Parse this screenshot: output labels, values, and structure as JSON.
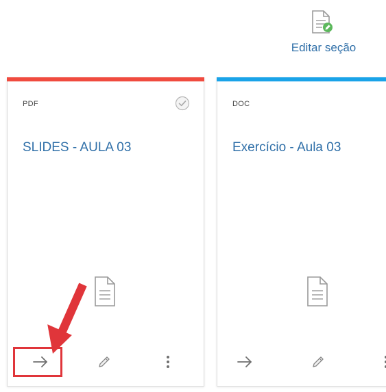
{
  "header": {
    "edit_section_label": "Editar seção",
    "edit_section_icon": "document-edit-icon"
  },
  "cards": [
    {
      "type": "PDF",
      "title": "SLIDES - AULA 03",
      "accent_color": "#f04b3f",
      "completed_icon": "check-circle-icon",
      "file_icon": "document-icon",
      "actions": [
        "arrow-right-icon",
        "pencil-icon",
        "more-vertical-icon"
      ]
    },
    {
      "type": "DOC",
      "title": "Exercício - Aula 03",
      "accent_color": "#1aa3e8",
      "file_icon": "document-icon",
      "actions": [
        "arrow-right-icon",
        "pencil-icon",
        "more-vertical-icon"
      ]
    }
  ],
  "annotation": {
    "color": "#e0353a",
    "points_to": "open-button"
  },
  "colors": {
    "link": "#2f6fa8",
    "icon_gray": "#9a9a9a",
    "edit_badge": "#5cb85c"
  }
}
